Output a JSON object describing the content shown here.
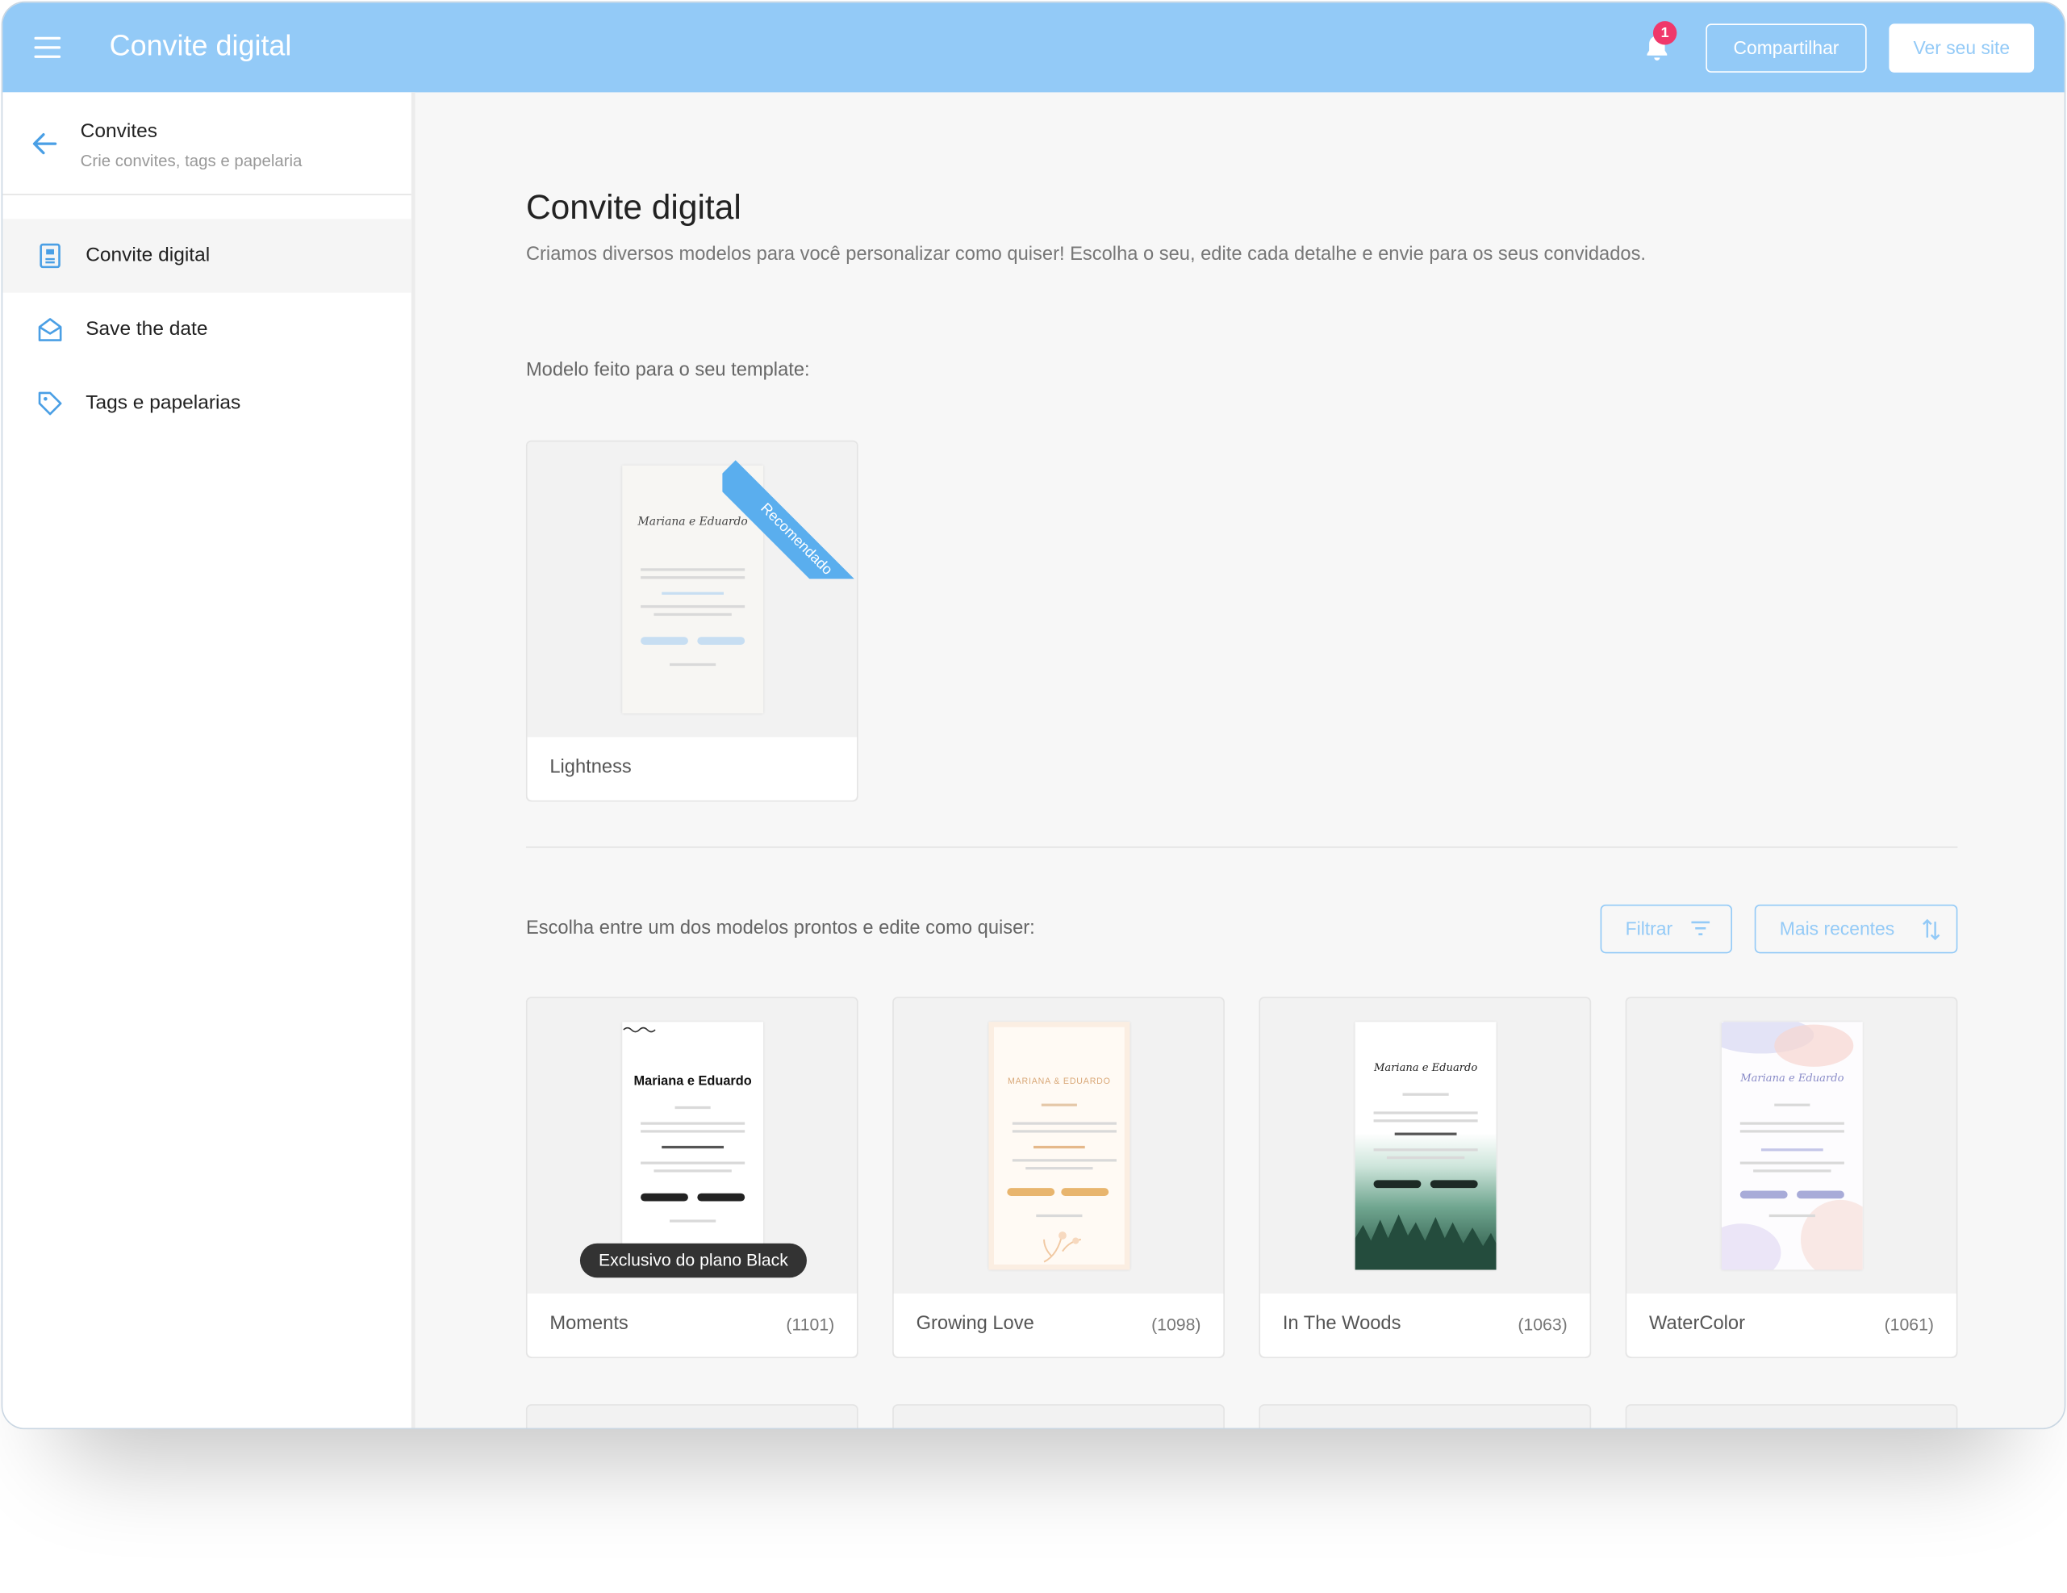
{
  "topbar": {
    "title": "Convite digital",
    "notification_count": "1",
    "share_label": "Compartilhar",
    "site_label": "Ver seu site"
  },
  "sidebar": {
    "title": "Convites",
    "subtitle": "Crie convites, tags e papelaria",
    "items": [
      {
        "label": "Convite digital",
        "icon": "invitation-icon"
      },
      {
        "label": "Save the date",
        "icon": "envelope-icon"
      },
      {
        "label": "Tags e papelarias",
        "icon": "tag-icon"
      }
    ]
  },
  "main": {
    "title": "Convite digital",
    "description": "Criamos diversos modelos para você personalizar como quiser! Escolha o seu, edite cada detalhe e envie para os seus convidados.",
    "recommended_heading": "Modelo feito para o seu template:",
    "recommended": {
      "name": "Lightness",
      "ribbon": "Recomendado",
      "preview_title": "Mariana e Eduardo"
    },
    "catalog_heading": "Escolha entre um dos modelos prontos e edite como quiser:",
    "filter_label": "Filtrar",
    "sort_label": "Mais recentes",
    "templates": [
      {
        "name": "Moments",
        "count": "(1101)",
        "badge": "Exclusivo do plano Black",
        "preview_title": "Mariana e Eduardo"
      },
      {
        "name": "Growing Love",
        "count": "(1098)",
        "preview_title": "MARIANA & EDUARDO"
      },
      {
        "name": "In The Woods",
        "count": "(1063)",
        "preview_title": "Mariana e Eduardo"
      },
      {
        "name": "WaterColor",
        "count": "(1061)",
        "preview_title": "Mariana e Eduardo"
      }
    ]
  },
  "colors": {
    "accent": "#93caf7",
    "ribbon": "#5aaeee",
    "badge": "#f0386b"
  }
}
